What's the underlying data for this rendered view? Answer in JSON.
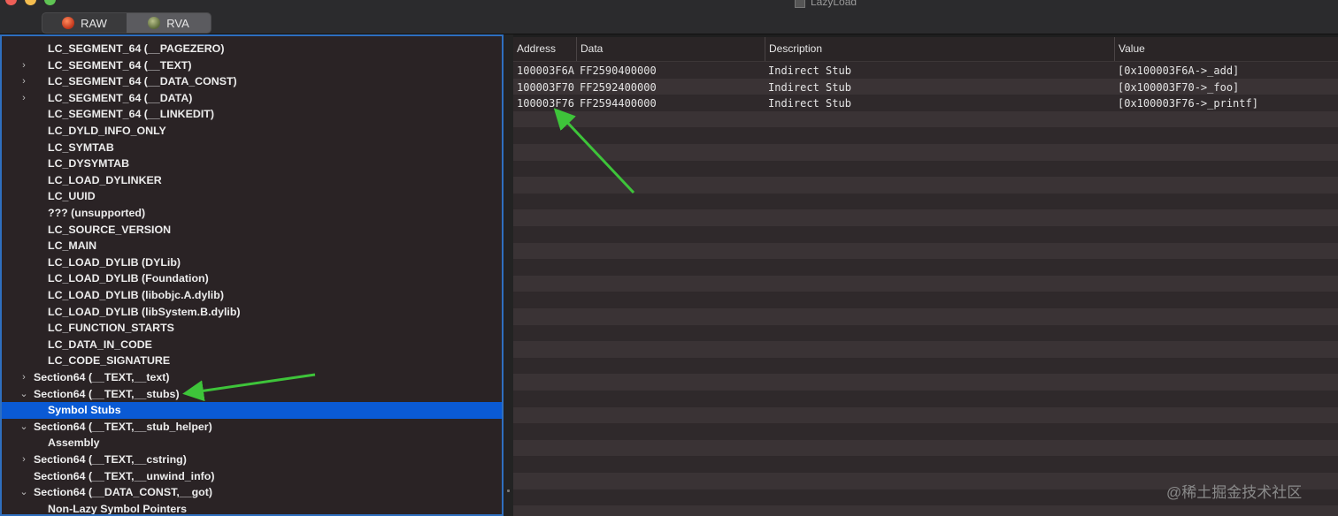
{
  "window": {
    "title": "LazyLoad"
  },
  "toolbar": {
    "segments": [
      {
        "label": "RAW",
        "active": false
      },
      {
        "label": "RVA",
        "active": true
      }
    ]
  },
  "tree": {
    "items": [
      {
        "label": "LC_SEGMENT_64 (__PAGEZERO)",
        "level": 1,
        "disclosure": ""
      },
      {
        "label": "LC_SEGMENT_64 (__TEXT)",
        "level": 1,
        "disclosure": "›"
      },
      {
        "label": "LC_SEGMENT_64 (__DATA_CONST)",
        "level": 1,
        "disclosure": "›"
      },
      {
        "label": "LC_SEGMENT_64 (__DATA)",
        "level": 1,
        "disclosure": "›"
      },
      {
        "label": "LC_SEGMENT_64 (__LINKEDIT)",
        "level": 1,
        "disclosure": ""
      },
      {
        "label": "LC_DYLD_INFO_ONLY",
        "level": 1,
        "disclosure": ""
      },
      {
        "label": "LC_SYMTAB",
        "level": 1,
        "disclosure": ""
      },
      {
        "label": "LC_DYSYMTAB",
        "level": 1,
        "disclosure": ""
      },
      {
        "label": "LC_LOAD_DYLINKER",
        "level": 1,
        "disclosure": ""
      },
      {
        "label": "LC_UUID",
        "level": 1,
        "disclosure": ""
      },
      {
        "label": "??? (unsupported)",
        "level": 1,
        "disclosure": ""
      },
      {
        "label": "LC_SOURCE_VERSION",
        "level": 1,
        "disclosure": ""
      },
      {
        "label": "LC_MAIN",
        "level": 1,
        "disclosure": ""
      },
      {
        "label": "LC_LOAD_DYLIB (DYLib)",
        "level": 1,
        "disclosure": ""
      },
      {
        "label": "LC_LOAD_DYLIB (Foundation)",
        "level": 1,
        "disclosure": ""
      },
      {
        "label": "LC_LOAD_DYLIB (libobjc.A.dylib)",
        "level": 1,
        "disclosure": ""
      },
      {
        "label": "LC_LOAD_DYLIB (libSystem.B.dylib)",
        "level": 1,
        "disclosure": ""
      },
      {
        "label": "LC_FUNCTION_STARTS",
        "level": 1,
        "disclosure": ""
      },
      {
        "label": "LC_DATA_IN_CODE",
        "level": 1,
        "disclosure": ""
      },
      {
        "label": "LC_CODE_SIGNATURE",
        "level": 1,
        "disclosure": ""
      },
      {
        "label": "Section64 (__TEXT,__text)",
        "level": 0,
        "disclosure": "›"
      },
      {
        "label": "Section64 (__TEXT,__stubs)",
        "level": 0,
        "disclosure": "⌄"
      },
      {
        "label": "Symbol Stubs",
        "level": 1,
        "disclosure": "",
        "selected": true
      },
      {
        "label": "Section64 (__TEXT,__stub_helper)",
        "level": 0,
        "disclosure": "⌄"
      },
      {
        "label": "Assembly",
        "level": 1,
        "disclosure": ""
      },
      {
        "label": "Section64 (__TEXT,__cstring)",
        "level": 0,
        "disclosure": "›"
      },
      {
        "label": "Section64 (__TEXT,__unwind_info)",
        "level": 0,
        "disclosure": ""
      },
      {
        "label": "Section64 (__DATA_CONST,__got)",
        "level": 0,
        "disclosure": "⌄"
      },
      {
        "label": "Non-Lazy Symbol Pointers",
        "level": 1,
        "disclosure": ""
      }
    ]
  },
  "table": {
    "columns": [
      "Address",
      "Data",
      "Description",
      "Value"
    ],
    "rows": [
      [
        "100003F6A",
        "FF2590400000",
        "Indirect Stub",
        "[0x100003F6A->_add]"
      ],
      [
        "100003F70",
        "FF2592400000",
        "Indirect Stub",
        "[0x100003F70->_foo]"
      ],
      [
        "100003F76",
        "FF2594400000",
        "Indirect Stub",
        "[0x100003F76->_printf]"
      ]
    ]
  },
  "colors": {
    "selection": "#0a5ad4",
    "annotation_arrow": "#3ec43a",
    "focus_ring": "#2f6fbf"
  },
  "watermark": "@稀土掘金技术社区"
}
